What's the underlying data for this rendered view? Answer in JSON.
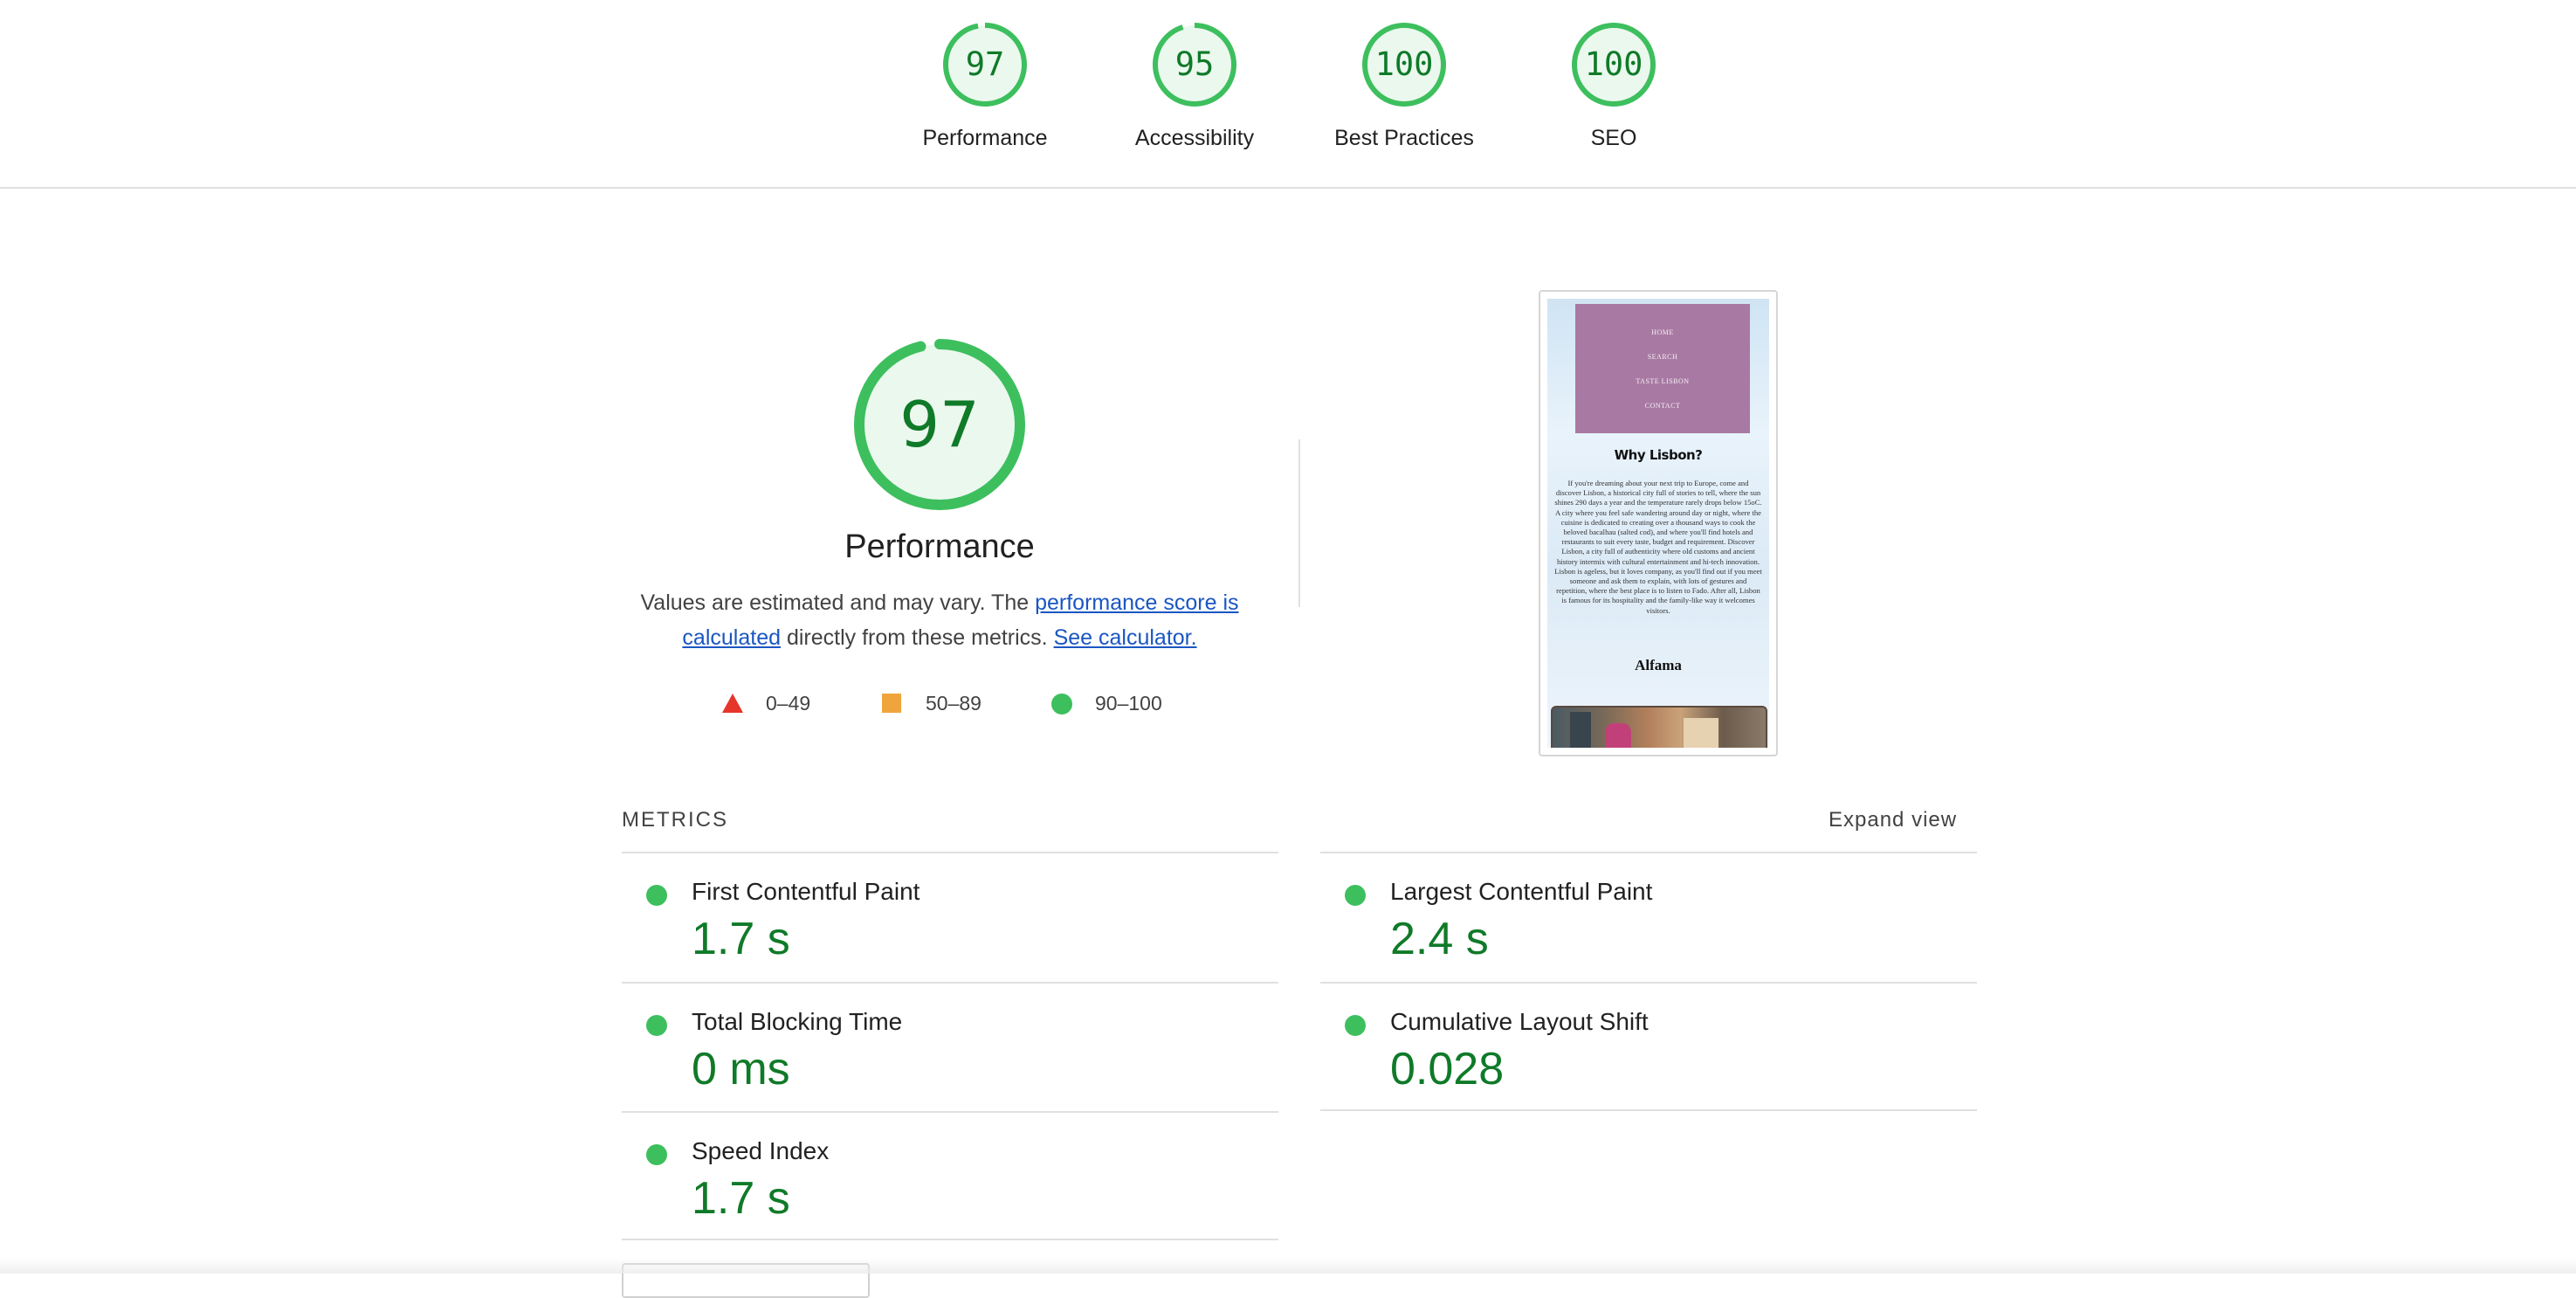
{
  "colors": {
    "pass": "#0f7a28",
    "pass_ring": "#3dbf5e",
    "pass_bg": "#ebf8ee",
    "average": "#f0a43c",
    "fail": "#e6352b",
    "link": "#1a56c2"
  },
  "summary": [
    {
      "label": "Performance",
      "score": "97"
    },
    {
      "label": "Accessibility",
      "score": "95"
    },
    {
      "label": "Best Practices",
      "score": "100"
    },
    {
      "label": "SEO",
      "score": "100"
    }
  ],
  "performance": {
    "score": "97",
    "title": "Performance",
    "desc_prefix": "Values are estimated and may vary. The ",
    "desc_link1": "performance score is calculated",
    "desc_middle": " directly from these metrics. ",
    "desc_link2": "See calculator."
  },
  "legend": [
    {
      "range": "0–49",
      "icon": "triangle-icon"
    },
    {
      "range": "50–89",
      "icon": "square-icon"
    },
    {
      "range": "90–100",
      "icon": "circle-icon"
    }
  ],
  "screenshot": {
    "nav": [
      "HOME",
      "SEARCH",
      "TASTE LISBON",
      "CONTACT"
    ],
    "heading": "Why Lisbon?",
    "body": "If you're dreaming about your next trip to Europe, come and discover Lisbon, a historical city full of stories to tell, where the sun shines 290 days a year and the temperature rarely drops below 15oC. A city where you feel safe wandering around day or night, where the cuisine is dedicated to creating over a thousand ways to cook the beloved bacalhau (salted cod), and where you'll find hotels and restaurants to suit every taste, budget and requirement. Discover Lisbon, a city full of authenticity where old customs and ancient history intermix with cultural entertainment and hi-tech innovation. Lisbon is ageless, but it loves company, as you'll find out if you meet someone and ask them to explain, with lots of gestures and repetition, where the best place is to listen to Fado. After all, Lisbon is famous for its hospitality and the family-like way it welcomes visitors.",
    "subheading": "Alfama"
  },
  "metrics": {
    "header": "METRICS",
    "expand_label": "Expand view",
    "items": [
      {
        "title": "First Contentful Paint",
        "value": "1.7 s"
      },
      {
        "title": "Largest Contentful Paint",
        "value": "2.4 s"
      },
      {
        "title": "Total Blocking Time",
        "value": "0 ms"
      },
      {
        "title": "Cumulative Layout Shift",
        "value": "0.028"
      },
      {
        "title": "Speed Index",
        "value": "1.7 s"
      }
    ]
  }
}
